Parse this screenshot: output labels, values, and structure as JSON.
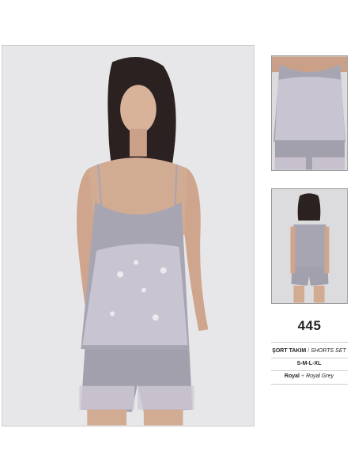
{
  "product": {
    "model_number": "445",
    "type_tr": "ŞORT TAKIM",
    "type_en": "SHORTS SET",
    "sizes": "S-M-L-XL",
    "color_tr": "Royal",
    "color_en": "Royal Grey",
    "separator_slash": "/",
    "separator_plus": "+"
  },
  "colors": {
    "garment": "#a8a5b2",
    "lace": "#cfc9d6",
    "background": "#e7e7e9",
    "skin": "#d8b39a",
    "hair": "#2b2120"
  }
}
